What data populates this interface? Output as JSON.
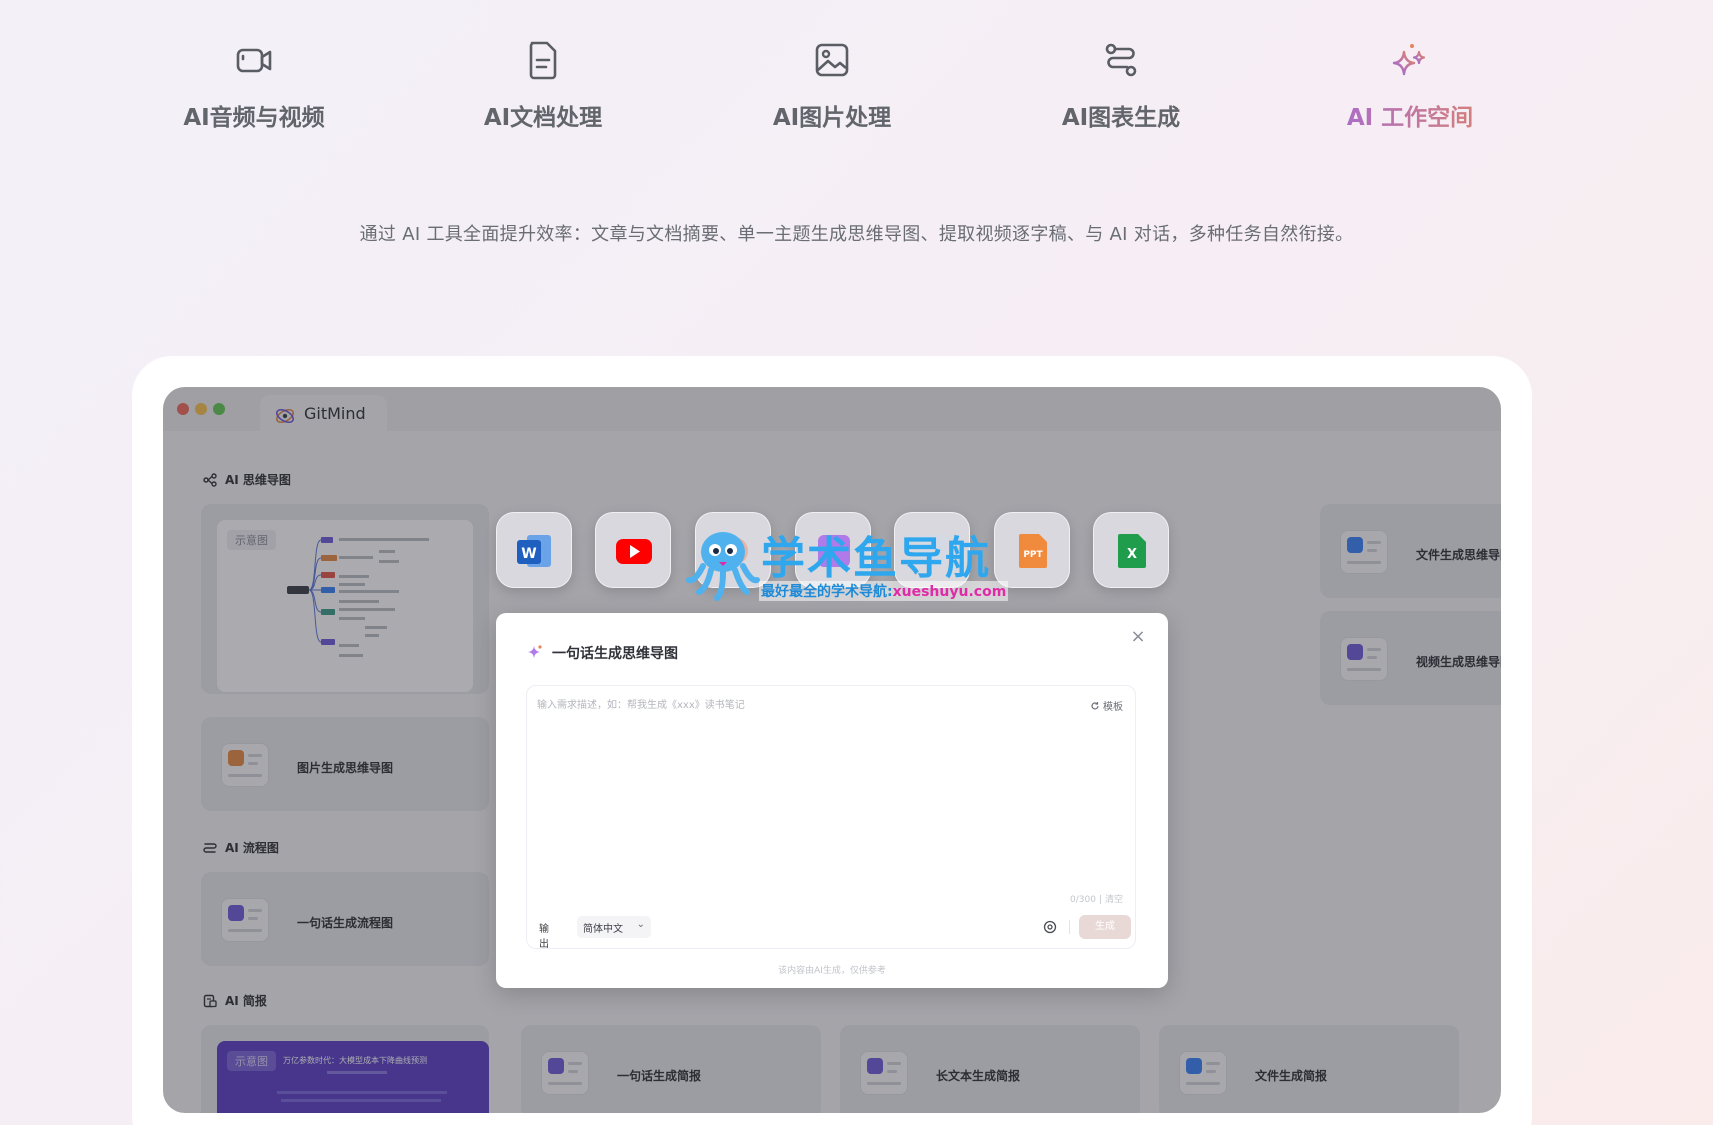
{
  "nav": {
    "items": [
      {
        "label": "AI音频与视频",
        "icon": "video-camera-icon"
      },
      {
        "label": "AI文档处理",
        "icon": "document-icon"
      },
      {
        "label": "AI图片处理",
        "icon": "image-icon"
      },
      {
        "label": "AI图表生成",
        "icon": "flow-chart-icon"
      },
      {
        "label": "AI 工作空间",
        "icon": "sparkles-icon",
        "active": true
      }
    ]
  },
  "tagline": "通过 AI 工具全面提升效率：文章与文档摘要、单一主题生成思维导图、提取视频逐字稿、与 AI 对话，多种任务自然衔接。",
  "window": {
    "tab_title": "GitMind",
    "sections": {
      "mindmap": {
        "title": "AI 思维导图",
        "example_badge": "示意图",
        "cards": [
          "文件生成思维导图",
          "视频生成思维导图",
          "图片生成思维导图"
        ]
      },
      "flowchart": {
        "title": "AI 流程图",
        "cards": [
          "一句话生成流程图"
        ]
      },
      "brief": {
        "title": "AI 简报",
        "example_badge": "示意图",
        "example_title": "万亿参数时代：大模型成本下降曲线预测",
        "cards": [
          "一句话生成简报",
          "长文本生成简报",
          "文件生成简报"
        ]
      }
    }
  },
  "apps": [
    "word-icon",
    "youtube-icon",
    "app-icon",
    "app-icon",
    "app-icon",
    "ppt-icon",
    "excel-icon"
  ],
  "watermark": {
    "title": "学术鱼导航",
    "subtitle": "最好最全的学术导航:",
    "domain": "xueshuyu.com"
  },
  "dialog": {
    "title": "一句话生成思维导图",
    "placeholder": "输入需求描述，如：帮我生成《xxx》读书笔记",
    "template_label": "模板",
    "counter": "0/300",
    "clear_label": "清空",
    "output_label": "输出",
    "language": "简体中文",
    "generate_label": "生成",
    "disclaimer": "该内容由AI生成，仅供参考"
  },
  "colors": {
    "accent_purple": "#9b67e6",
    "accent_orange": "#e4855c",
    "card_bg": "#e4e4ea",
    "slide_purple": "#5b3fc4"
  }
}
